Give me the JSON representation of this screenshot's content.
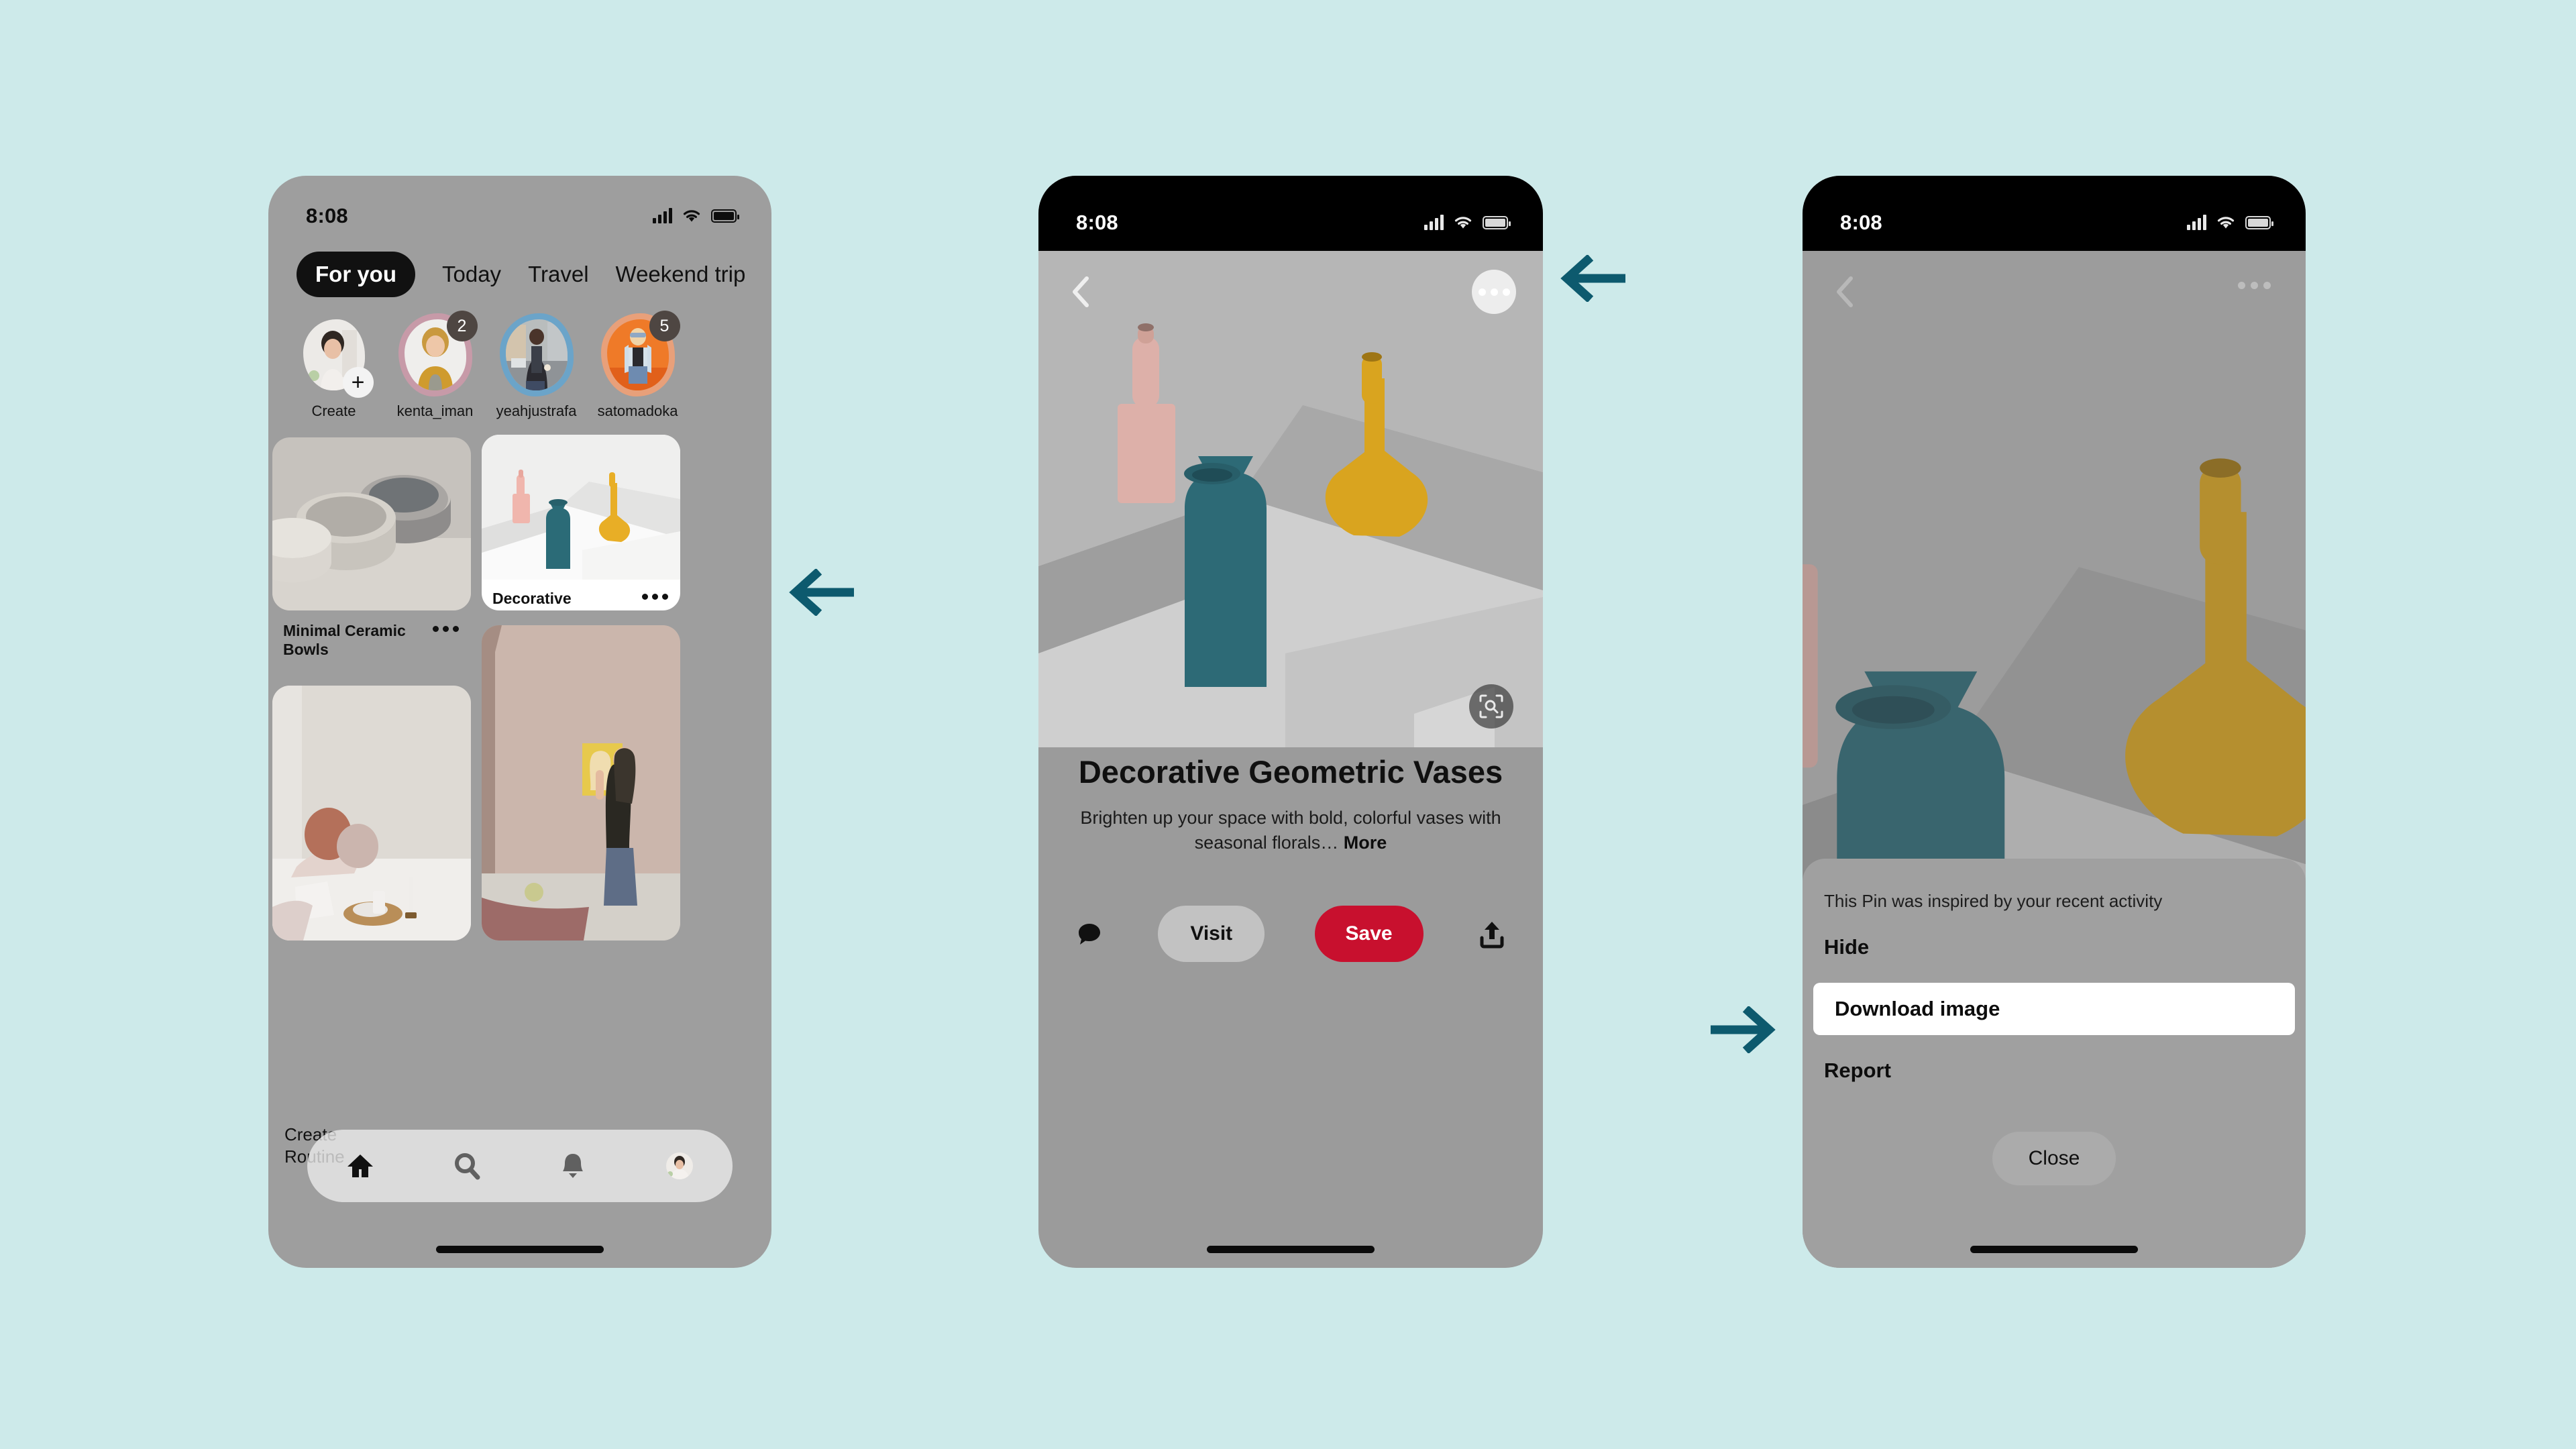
{
  "background_color": "#cdeaea",
  "accent_arrow_color": "#0d5a6e",
  "brand_red": "#c8102e",
  "phone1": {
    "name": "pinterest-home-feed",
    "status": {
      "time": "8:08",
      "signal_icon": "cellular-bars-icon",
      "wifi_icon": "wifi-icon",
      "battery_icon": "battery-full-icon"
    },
    "tabs": [
      {
        "label": "For you",
        "active": true
      },
      {
        "label": "Today",
        "active": false
      },
      {
        "label": "Travel",
        "active": false
      },
      {
        "label": "Weekend trip",
        "active": false
      }
    ],
    "avatars": [
      {
        "name": "Create",
        "badge": "",
        "plus": "+",
        "ring": "none"
      },
      {
        "name": "kenta_iman",
        "badge": "2",
        "plus": "",
        "ring": "#c79aa8"
      },
      {
        "name": "yeahjustrafa",
        "badge": "",
        "plus": "",
        "ring": "#6ba4c9"
      },
      {
        "name": "satomadoka",
        "badge": "5",
        "plus": "",
        "ring": "#e8a07a"
      }
    ],
    "pins": [
      {
        "title": "Minimal Ceramic Bowls",
        "menu_icon": "ellipsis-icon",
        "image": "ceramic-bowls"
      },
      {
        "title": "Decorative Geometric Vases",
        "menu_icon": "ellipsis-icon",
        "image": "geometric-vases",
        "selected": true
      },
      {
        "title": "",
        "menu_icon": "",
        "image": "bedroom-linens"
      },
      {
        "title": "",
        "menu_icon": "",
        "image": "woman-hanging-art"
      }
    ],
    "create_routine_label": "Create\nRoutine",
    "nav": [
      {
        "icon": "home-icon",
        "active": true
      },
      {
        "icon": "search-icon",
        "active": false
      },
      {
        "icon": "bell-icon",
        "active": false
      },
      {
        "icon": "avatar-icon",
        "active": false
      }
    ]
  },
  "phone2": {
    "name": "pin-detail-view",
    "status": {
      "time": "8:08",
      "signal_icon": "cellular-bars-icon",
      "wifi_icon": "wifi-icon",
      "battery_icon": "battery-full-icon"
    },
    "back_icon": "chevron-left-icon",
    "more_icon": "ellipsis-icon",
    "lens_icon": "visual-search-lens-icon",
    "title": "Decorative Geometric Vases",
    "description": "Brighten up your space with bold, colorful vases with seasonal florals…",
    "more_link": "More",
    "comment_icon": "comment-bubble-icon",
    "visit_label": "Visit",
    "save_label": "Save",
    "share_icon": "share-upload-icon"
  },
  "phone3": {
    "name": "pin-options-action-sheet",
    "status": {
      "time": "8:08",
      "signal_icon": "cellular-bars-icon",
      "wifi_icon": "wifi-icon",
      "battery_icon": "battery-full-icon"
    },
    "back_icon": "chevron-left-icon",
    "more_icon": "ellipsis-icon",
    "sheet_subtitle": "This Pin was inspired by your recent activity",
    "options": [
      {
        "label": "Hide",
        "highlighted": false
      },
      {
        "label": "Download image",
        "highlighted": true
      },
      {
        "label": "Report",
        "highlighted": false
      }
    ],
    "close_label": "Close"
  },
  "annotations": [
    {
      "name": "arrow-to-pin-card",
      "direction": "left"
    },
    {
      "name": "arrow-to-more-button",
      "direction": "left"
    },
    {
      "name": "arrow-to-download-image",
      "direction": "right"
    }
  ]
}
